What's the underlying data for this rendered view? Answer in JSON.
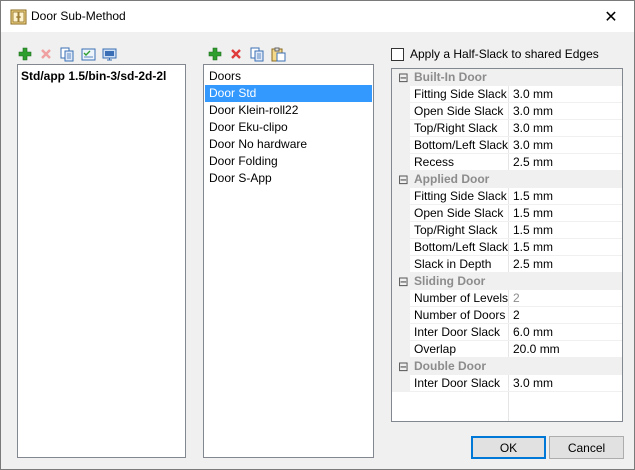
{
  "window": {
    "title": "Door Sub-Method",
    "close_glyph": "✕"
  },
  "left_panel": {
    "toolbar": [
      {
        "icon": "add-icon",
        "color": "#2e9e2e"
      },
      {
        "icon": "delete-icon",
        "color": "#e03b3b"
      },
      {
        "icon": "copy-icon",
        "color": "#3b6fb5"
      },
      {
        "icon": "properties-icon",
        "color": "#3b6fb5"
      },
      {
        "icon": "monitor-icon",
        "color": "#3b6fb5"
      }
    ],
    "item": "Std/app 1.5/bin-3/sd-2d-2l"
  },
  "middle_panel": {
    "toolbar": [
      {
        "icon": "add-icon",
        "color": "#2e9e2e"
      },
      {
        "icon": "delete-icon",
        "color": "#e03b3b"
      },
      {
        "icon": "copy-icon",
        "color": "#3b6fb5"
      },
      {
        "icon": "paste-icon",
        "color": "#c9a23b"
      }
    ],
    "items": [
      "Doors",
      "Door Std",
      "Door Klein-roll22",
      "Door Eku-clipo",
      "Door No hardware",
      "Door Folding",
      "Door S-App"
    ],
    "selected_index": 1
  },
  "half_slack": {
    "label": "Apply a Half-Slack to shared Edges",
    "checked": false
  },
  "grid": {
    "categories": [
      {
        "name": "Built-In Door",
        "toggle": "⊟",
        "props": [
          {
            "name": "Fitting Side Slack",
            "value": "3.0 mm"
          },
          {
            "name": "Open Side Slack",
            "value": "3.0 mm"
          },
          {
            "name": "Top/Right Slack",
            "value": "3.0 mm"
          },
          {
            "name": "Bottom/Left Slack",
            "value": "3.0 mm"
          },
          {
            "name": "Recess",
            "value": "2.5 mm"
          }
        ]
      },
      {
        "name": "Applied Door",
        "toggle": "⊟",
        "props": [
          {
            "name": "Fitting Side Slack",
            "value": "1.5 mm"
          },
          {
            "name": "Open Side Slack",
            "value": "1.5 mm"
          },
          {
            "name": "Top/Right Slack",
            "value": "1.5 mm"
          },
          {
            "name": "Bottom/Left Slack",
            "value": "1.5 mm"
          },
          {
            "name": "Slack in Depth",
            "value": "2.5 mm"
          }
        ]
      },
      {
        "name": "Sliding Door",
        "toggle": "⊟",
        "props": [
          {
            "name": "Number of Levels",
            "value": "2",
            "readonly": true
          },
          {
            "name": "Number of Doors",
            "value": "2"
          },
          {
            "name": "Inter Door Slack",
            "value": "6.0 mm"
          },
          {
            "name": "Overlap",
            "value": "20.0 mm"
          }
        ]
      },
      {
        "name": "Double Door",
        "toggle": "⊟",
        "props": [
          {
            "name": "Inter Door Slack",
            "value": "3.0 mm"
          }
        ]
      }
    ]
  },
  "buttons": {
    "ok": "OK",
    "cancel": "Cancel"
  }
}
